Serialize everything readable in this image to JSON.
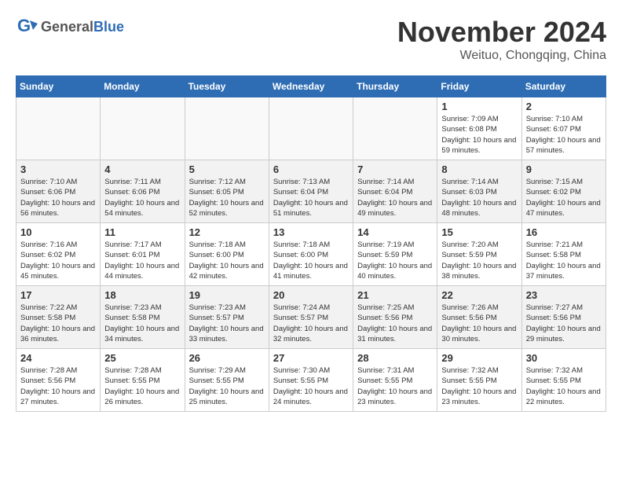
{
  "header": {
    "logo_general": "General",
    "logo_blue": "Blue",
    "month": "November 2024",
    "location": "Weituo, Chongqing, China"
  },
  "weekdays": [
    "Sunday",
    "Monday",
    "Tuesday",
    "Wednesday",
    "Thursday",
    "Friday",
    "Saturday"
  ],
  "weeks": [
    [
      {
        "day": "",
        "info": ""
      },
      {
        "day": "",
        "info": ""
      },
      {
        "day": "",
        "info": ""
      },
      {
        "day": "",
        "info": ""
      },
      {
        "day": "",
        "info": ""
      },
      {
        "day": "1",
        "info": "Sunrise: 7:09 AM\nSunset: 6:08 PM\nDaylight: 10 hours and 59 minutes."
      },
      {
        "day": "2",
        "info": "Sunrise: 7:10 AM\nSunset: 6:07 PM\nDaylight: 10 hours and 57 minutes."
      }
    ],
    [
      {
        "day": "3",
        "info": "Sunrise: 7:10 AM\nSunset: 6:06 PM\nDaylight: 10 hours and 56 minutes."
      },
      {
        "day": "4",
        "info": "Sunrise: 7:11 AM\nSunset: 6:06 PM\nDaylight: 10 hours and 54 minutes."
      },
      {
        "day": "5",
        "info": "Sunrise: 7:12 AM\nSunset: 6:05 PM\nDaylight: 10 hours and 52 minutes."
      },
      {
        "day": "6",
        "info": "Sunrise: 7:13 AM\nSunset: 6:04 PM\nDaylight: 10 hours and 51 minutes."
      },
      {
        "day": "7",
        "info": "Sunrise: 7:14 AM\nSunset: 6:04 PM\nDaylight: 10 hours and 49 minutes."
      },
      {
        "day": "8",
        "info": "Sunrise: 7:14 AM\nSunset: 6:03 PM\nDaylight: 10 hours and 48 minutes."
      },
      {
        "day": "9",
        "info": "Sunrise: 7:15 AM\nSunset: 6:02 PM\nDaylight: 10 hours and 47 minutes."
      }
    ],
    [
      {
        "day": "10",
        "info": "Sunrise: 7:16 AM\nSunset: 6:02 PM\nDaylight: 10 hours and 45 minutes."
      },
      {
        "day": "11",
        "info": "Sunrise: 7:17 AM\nSunset: 6:01 PM\nDaylight: 10 hours and 44 minutes."
      },
      {
        "day": "12",
        "info": "Sunrise: 7:18 AM\nSunset: 6:00 PM\nDaylight: 10 hours and 42 minutes."
      },
      {
        "day": "13",
        "info": "Sunrise: 7:18 AM\nSunset: 6:00 PM\nDaylight: 10 hours and 41 minutes."
      },
      {
        "day": "14",
        "info": "Sunrise: 7:19 AM\nSunset: 5:59 PM\nDaylight: 10 hours and 40 minutes."
      },
      {
        "day": "15",
        "info": "Sunrise: 7:20 AM\nSunset: 5:59 PM\nDaylight: 10 hours and 38 minutes."
      },
      {
        "day": "16",
        "info": "Sunrise: 7:21 AM\nSunset: 5:58 PM\nDaylight: 10 hours and 37 minutes."
      }
    ],
    [
      {
        "day": "17",
        "info": "Sunrise: 7:22 AM\nSunset: 5:58 PM\nDaylight: 10 hours and 36 minutes."
      },
      {
        "day": "18",
        "info": "Sunrise: 7:23 AM\nSunset: 5:58 PM\nDaylight: 10 hours and 34 minutes."
      },
      {
        "day": "19",
        "info": "Sunrise: 7:23 AM\nSunset: 5:57 PM\nDaylight: 10 hours and 33 minutes."
      },
      {
        "day": "20",
        "info": "Sunrise: 7:24 AM\nSunset: 5:57 PM\nDaylight: 10 hours and 32 minutes."
      },
      {
        "day": "21",
        "info": "Sunrise: 7:25 AM\nSunset: 5:56 PM\nDaylight: 10 hours and 31 minutes."
      },
      {
        "day": "22",
        "info": "Sunrise: 7:26 AM\nSunset: 5:56 PM\nDaylight: 10 hours and 30 minutes."
      },
      {
        "day": "23",
        "info": "Sunrise: 7:27 AM\nSunset: 5:56 PM\nDaylight: 10 hours and 29 minutes."
      }
    ],
    [
      {
        "day": "24",
        "info": "Sunrise: 7:28 AM\nSunset: 5:56 PM\nDaylight: 10 hours and 27 minutes."
      },
      {
        "day": "25",
        "info": "Sunrise: 7:28 AM\nSunset: 5:55 PM\nDaylight: 10 hours and 26 minutes."
      },
      {
        "day": "26",
        "info": "Sunrise: 7:29 AM\nSunset: 5:55 PM\nDaylight: 10 hours and 25 minutes."
      },
      {
        "day": "27",
        "info": "Sunrise: 7:30 AM\nSunset: 5:55 PM\nDaylight: 10 hours and 24 minutes."
      },
      {
        "day": "28",
        "info": "Sunrise: 7:31 AM\nSunset: 5:55 PM\nDaylight: 10 hours and 23 minutes."
      },
      {
        "day": "29",
        "info": "Sunrise: 7:32 AM\nSunset: 5:55 PM\nDaylight: 10 hours and 23 minutes."
      },
      {
        "day": "30",
        "info": "Sunrise: 7:32 AM\nSunset: 5:55 PM\nDaylight: 10 hours and 22 minutes."
      }
    ]
  ]
}
